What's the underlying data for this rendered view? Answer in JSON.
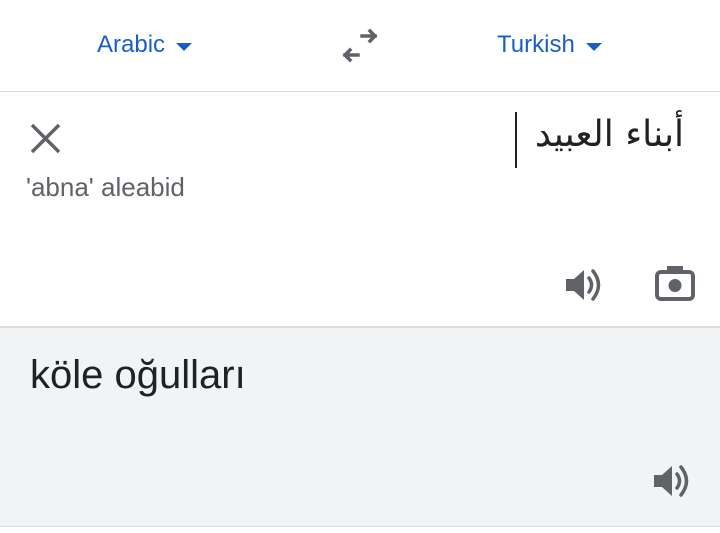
{
  "languages": {
    "source": "Arabic",
    "target": "Turkish"
  },
  "input": {
    "text": "أبناء العبيد",
    "transliteration": "'abna' aleabid"
  },
  "output": {
    "translation": "köle oğulları"
  },
  "icons": {
    "swap": "swap-languages-icon",
    "clear": "close-icon",
    "listen_source": "speaker-icon",
    "camera": "camera-icon",
    "listen_translation": "speaker-icon"
  },
  "colors": {
    "accent": "#1a5fc7",
    "icon": "#5f6368",
    "output_background": "#f1f3f4",
    "divider": "#dadce0"
  }
}
